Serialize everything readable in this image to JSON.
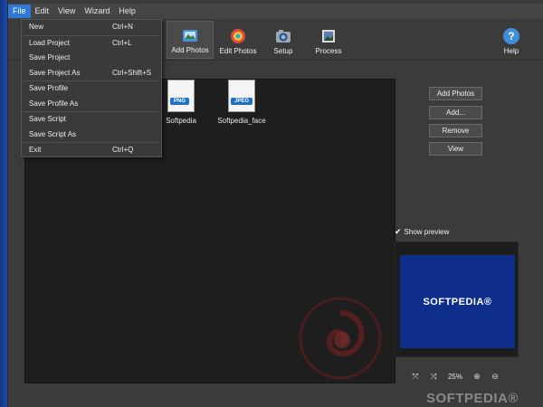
{
  "menubar": {
    "items": [
      "File",
      "Edit",
      "View",
      "Wizard",
      "Help"
    ]
  },
  "toolbar": {
    "buttons": [
      {
        "label": "Add Photos",
        "icon": "add-photos-icon",
        "selected": true
      },
      {
        "label": "Edit Photos",
        "icon": "edit-photos-icon"
      },
      {
        "label": "Setup",
        "icon": "setup-icon"
      },
      {
        "label": "Process",
        "icon": "process-icon"
      },
      {
        "label": "Help",
        "icon": "help-icon"
      }
    ]
  },
  "file_menu": {
    "items": [
      {
        "label": "New",
        "shortcut": "Ctrl+N"
      },
      {
        "label": "Load Project",
        "shortcut": "Ctrl+L"
      },
      {
        "label": "Save Project",
        "shortcut": ""
      },
      {
        "label": "Save Project As",
        "shortcut": "Ctrl+Shift+S"
      },
      {
        "label": "Save Profile",
        "shortcut": ""
      },
      {
        "label": "Save Profile As",
        "shortcut": ""
      },
      {
        "label": "Save Script",
        "shortcut": ""
      },
      {
        "label": "Save Script As",
        "shortcut": ""
      },
      {
        "label": "Exit",
        "shortcut": "Ctrl+Q"
      }
    ]
  },
  "files": [
    {
      "name": "Softpedia",
      "type": "PNG"
    },
    {
      "name": "Softpedia_face",
      "type": "JPEG"
    }
  ],
  "side_buttons": [
    "Add Photos",
    "Add...",
    "Remove",
    "View"
  ],
  "preview": {
    "checkbox_label": "Show preview",
    "checked": true,
    "image_text": "SOFTPEDIA®"
  },
  "zoom": {
    "level": "25%"
  },
  "watermark": "SOFTPEDIA®",
  "colors": {
    "accent": "#2f78d6",
    "preview_bg": "#0f2d8b"
  }
}
